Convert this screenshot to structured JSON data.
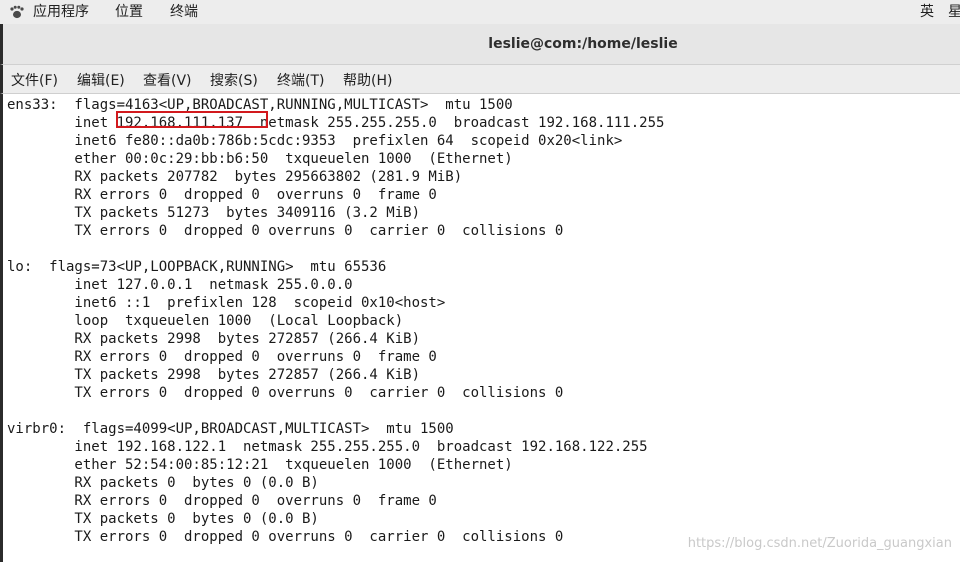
{
  "topbar": {
    "applications": "应用程序",
    "places": "位置",
    "terminal": "终端",
    "input_method": "英",
    "day": "星",
    "app_icon": "gnome-foot-icon"
  },
  "window": {
    "title": "leslie@com:/home/leslie"
  },
  "menu": [
    "文件(F)",
    "编辑(E)",
    "查看(V)",
    "搜索(S)",
    "终端(T)",
    "帮助(H)"
  ],
  "terminal_lines": [
    "ens33:  flags=4163<UP,BROADCAST,RUNNING,MULTICAST>  mtu 1500",
    "        inet 192.168.111.137  netmask 255.255.255.0  broadcast 192.168.111.255",
    "        inet6 fe80::da0b:786b:5cdc:9353  prefixlen 64  scopeid 0x20<link>",
    "        ether 00:0c:29:bb:b6:50  txqueuelen 1000  (Ethernet)",
    "        RX packets 207782  bytes 295663802 (281.9 MiB)",
    "        RX errors 0  dropped 0  overruns 0  frame 0",
    "        TX packets 51273  bytes 3409116 (3.2 MiB)",
    "        TX errors 0  dropped 0 overruns 0  carrier 0  collisions 0",
    "",
    "lo:  flags=73<UP,LOOPBACK,RUNNING>  mtu 65536",
    "        inet 127.0.0.1  netmask 255.0.0.0",
    "        inet6 ::1  prefixlen 128  scopeid 0x10<host>",
    "        loop  txqueuelen 1000  (Local Loopback)",
    "        RX packets 2998  bytes 272857 (266.4 KiB)",
    "        RX errors 0  dropped 0  overruns 0  frame 0",
    "        TX packets 2998  bytes 272857 (266.4 KiB)",
    "        TX errors 0  dropped 0 overruns 0  carrier 0  collisions 0",
    "",
    "virbr0:  flags=4099<UP,BROADCAST,MULTICAST>  mtu 1500",
    "        inet 192.168.122.1  netmask 255.255.255.0  broadcast 192.168.122.255",
    "        ether 52:54:00:85:12:21  txqueuelen 1000  (Ethernet)",
    "        RX packets 0  bytes 0 (0.0 B)",
    "        RX errors 0  dropped 0  overruns 0  frame 0",
    "        TX packets 0  bytes 0 (0.0 B)",
    "        TX errors 0  dropped 0 overruns 0  carrier 0  collisions 0"
  ],
  "highlight": {
    "text": "192.168.111.137",
    "color": "#d2191d"
  },
  "watermark": "https://blog.csdn.net/Zuorida_guangxian"
}
